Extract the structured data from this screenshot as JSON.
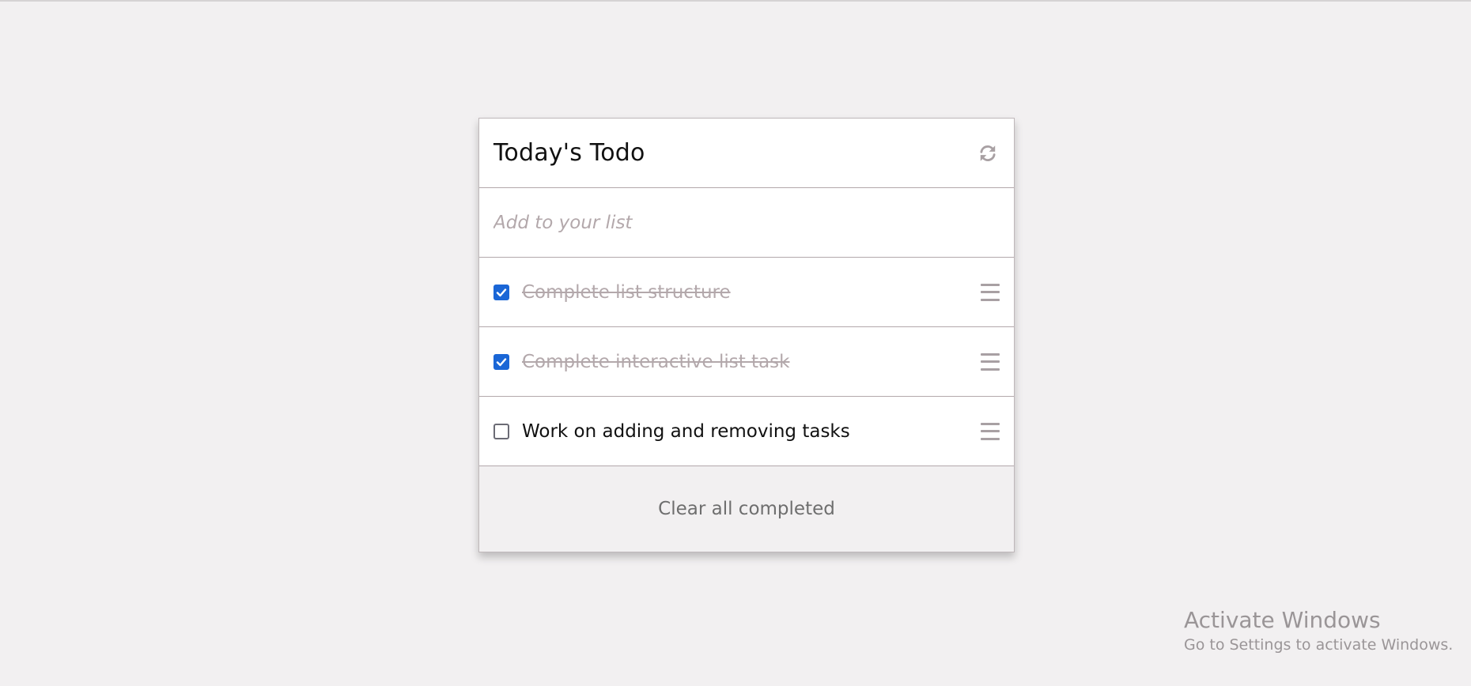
{
  "card": {
    "title": "Today's Todo",
    "refresh_icon": "refresh-icon",
    "input_placeholder": "Add to your list",
    "items": [
      {
        "label": "Complete list structure",
        "completed": true,
        "handle_icon": "drag-handle-icon"
      },
      {
        "label": "Complete interactive list task",
        "completed": true,
        "handle_icon": "drag-handle-icon"
      },
      {
        "label": "Work on adding and removing tasks",
        "completed": false,
        "handle_icon": "drag-handle-icon"
      }
    ],
    "clear_label": "Clear all completed"
  },
  "watermark": {
    "title": "Activate Windows",
    "subtitle": "Go to Settings to activate Windows."
  },
  "colors": {
    "background": "#f2f0f1",
    "card": "#ffffff",
    "divider": "#b3a8ab",
    "checkbox_checked": "#1a66d6",
    "completed_text": "#b3a8ab",
    "muted_icon": "#a8a0a3"
  }
}
